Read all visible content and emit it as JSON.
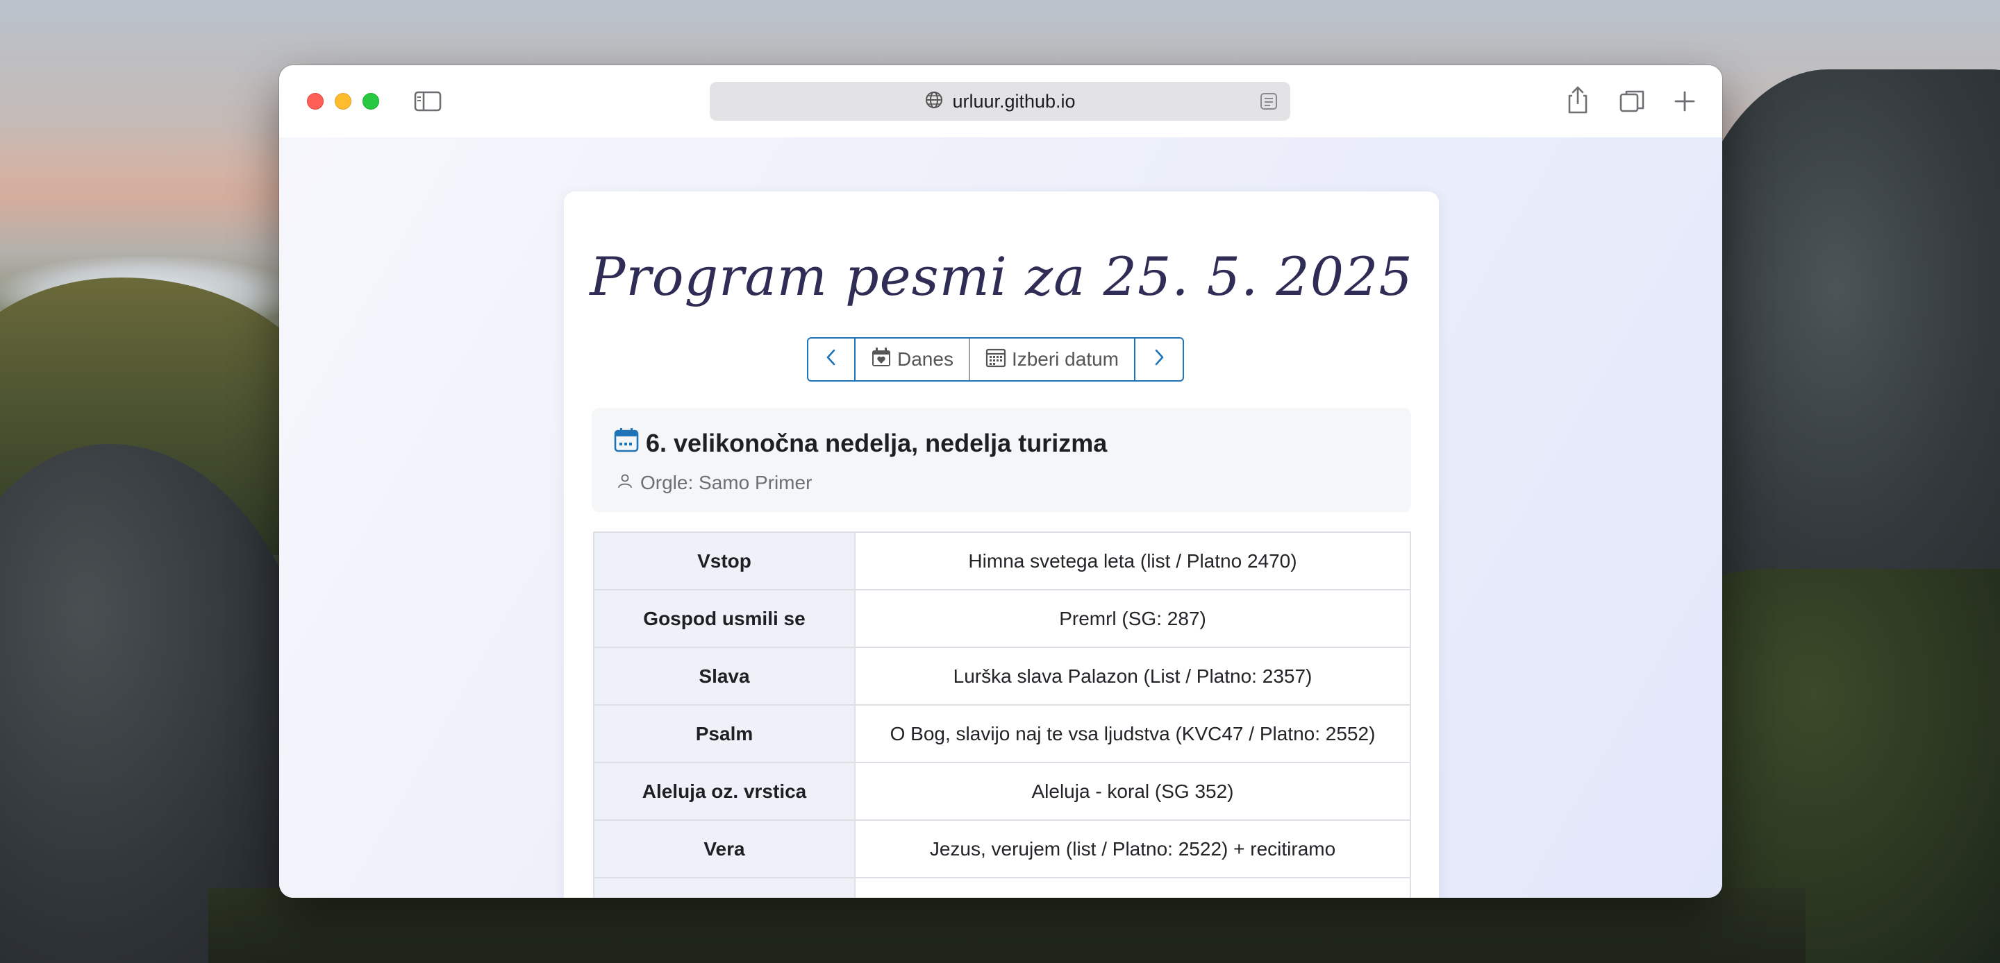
{
  "browser": {
    "address": "urluur.github.io"
  },
  "page": {
    "title": "Program pesmi za 25. 5. 2025",
    "nav": {
      "today_label": "Danes",
      "pick_date_label": "Izberi datum"
    },
    "occasion": "6. velikonočna nedelja, nedelja turizma",
    "organist": "Orgle: Samo Primer",
    "songs": [
      {
        "part": "Vstop",
        "song": "Himna svetega leta (list / Platno 2470)"
      },
      {
        "part": "Gospod usmili se",
        "song": "Premrl (SG: 287)"
      },
      {
        "part": "Slava",
        "song": "Lurška slava Palazon (List / Platno: 2357)"
      },
      {
        "part": "Psalm",
        "song": "O Bog, slavijo naj te vsa ljudstva (KVC47 / Platno: 2552)"
      },
      {
        "part": "Aleluja oz. vrstica",
        "song": "Aleluja - koral (SG 352)"
      },
      {
        "part": "Vera",
        "song": "Jezus, verujem (list / Platno: 2522) + recitiramo"
      },
      {
        "part": "",
        "song": ""
      }
    ]
  },
  "icons": {
    "sidebar": "sidebar-icon",
    "globe": "globe-icon",
    "reader": "reader-icon",
    "share": "share-icon",
    "tabs": "tabs-overview-icon",
    "new_tab": "plus-icon",
    "prev": "chevron-left-icon",
    "next": "chevron-right-icon",
    "today": "calendar-heart-icon",
    "pick": "calendar-grid-icon",
    "occasion": "calendar-icon",
    "organist": "person-icon"
  },
  "colors": {
    "accent": "#1f73b7",
    "title": "#2f2d55",
    "row_header_bg": "#eef2f8"
  }
}
